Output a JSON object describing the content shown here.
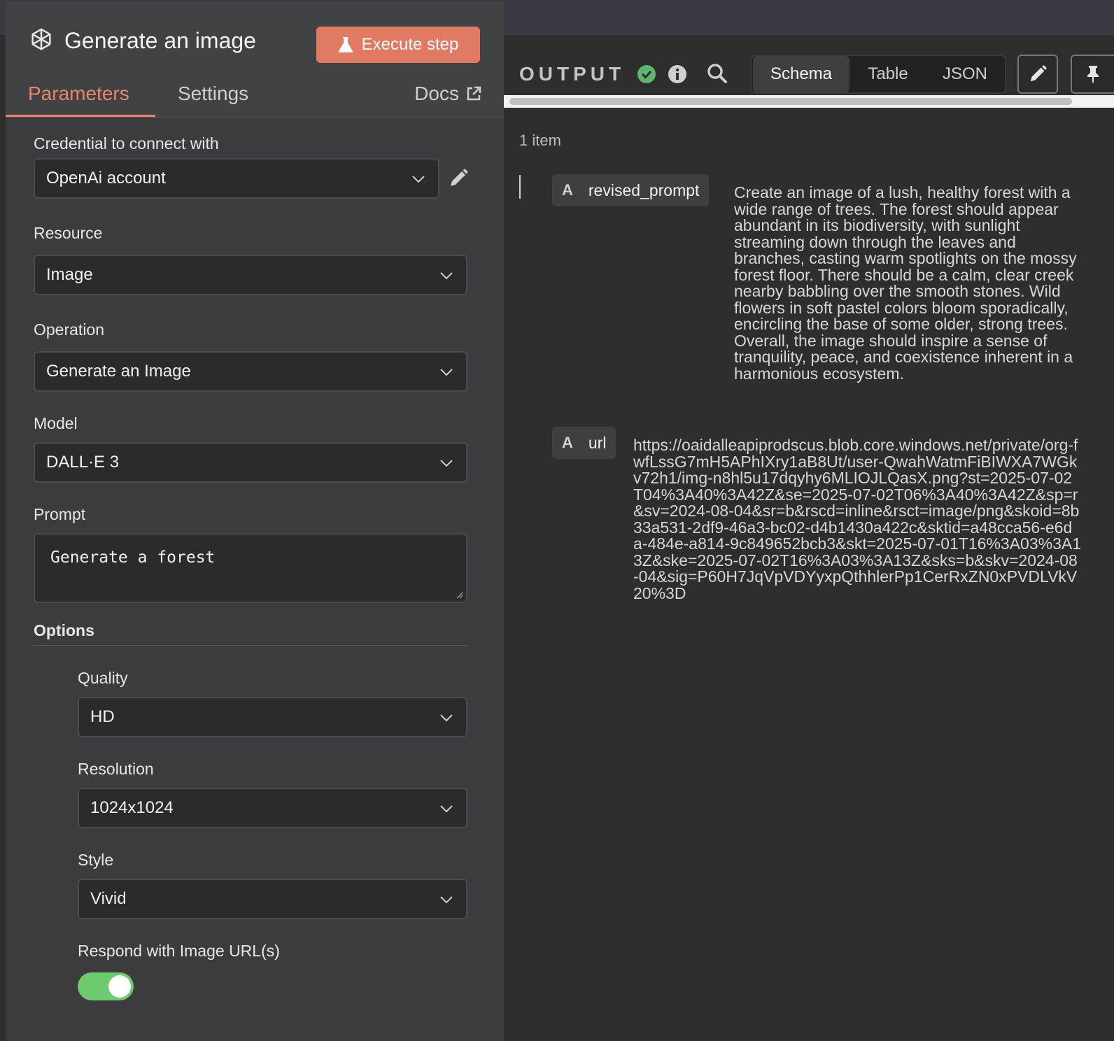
{
  "node": {
    "title": "Generate an image",
    "execute_label": "Execute step",
    "icon": "openai-icon"
  },
  "tabs": {
    "parameters": "Parameters",
    "settings": "Settings",
    "docs": "Docs"
  },
  "fields": {
    "credential_label": "Credential to connect with",
    "credential_value": "OpenAi account",
    "resource_label": "Resource",
    "resource_value": "Image",
    "operation_label": "Operation",
    "operation_value": "Generate an Image",
    "model_label": "Model",
    "model_value": "DALL·E 3",
    "prompt_label": "Prompt",
    "prompt_value": "Generate a forest",
    "options_label": "Options",
    "quality_label": "Quality",
    "quality_value": "HD",
    "resolution_label": "Resolution",
    "resolution_value": "1024x1024",
    "style_label": "Style",
    "style_value": "Vivid",
    "respond_label": "Respond with Image URL(s)",
    "respond_enabled": true
  },
  "output": {
    "title": "OUTPUT",
    "status": "success",
    "views": [
      "Schema",
      "Table",
      "JSON"
    ],
    "active_view": "Schema",
    "item_count": "1 item",
    "rows": [
      {
        "type": "A",
        "key": "revised_prompt",
        "value": "Create an image of a lush, healthy forest with a wide range of trees. The forest should appear abundant in its biodiversity, with sunlight streaming down through the leaves and branches, casting warm spotlights on the mossy forest floor. There should be a calm, clear creek nearby babbling over the smooth stones. Wild flowers in soft pastel colors bloom sporadically, encircling the base of some older, strong trees. Overall, the image should inspire a sense of tranquility, peace, and coexistence inherent in a harmonious ecosystem."
      },
      {
        "type": "A",
        "key": "url",
        "value": "https://oaidalleapiprodscus.blob.core.windows.net/private/org-fwfLssG7mH5APhIXry1aB8Ut/user-QwahWatmFiBIWXA7WGkv72h1/img-n8hl5u17dqyhy6MLIOJLQasX.png?st=2025-07-02T04%3A40%3A42Z&se=2025-07-02T06%3A40%3A42Z&sp=r&sv=2024-08-04&sr=b&rscd=inline&rsct=image/png&skoid=8b33a531-2df9-46a3-bc02-d4b1430a422c&sktid=a48cca56-e6da-484e-a814-9c849652bcb3&skt=2025-07-01T16%3A03%3A13Z&ske=2025-07-02T16%3A03%3A13Z&sks=b&skv=2024-08-04&sig=P60H7JqVpVDYyxpQthhlerPp1CerRxZN0xPVDLVkV20%3D"
      }
    ]
  },
  "colors": {
    "accent": "#e07a62",
    "tab_active": "#e8866a",
    "success": "#5fb56b",
    "toggle_on": "#6ccb6c"
  }
}
